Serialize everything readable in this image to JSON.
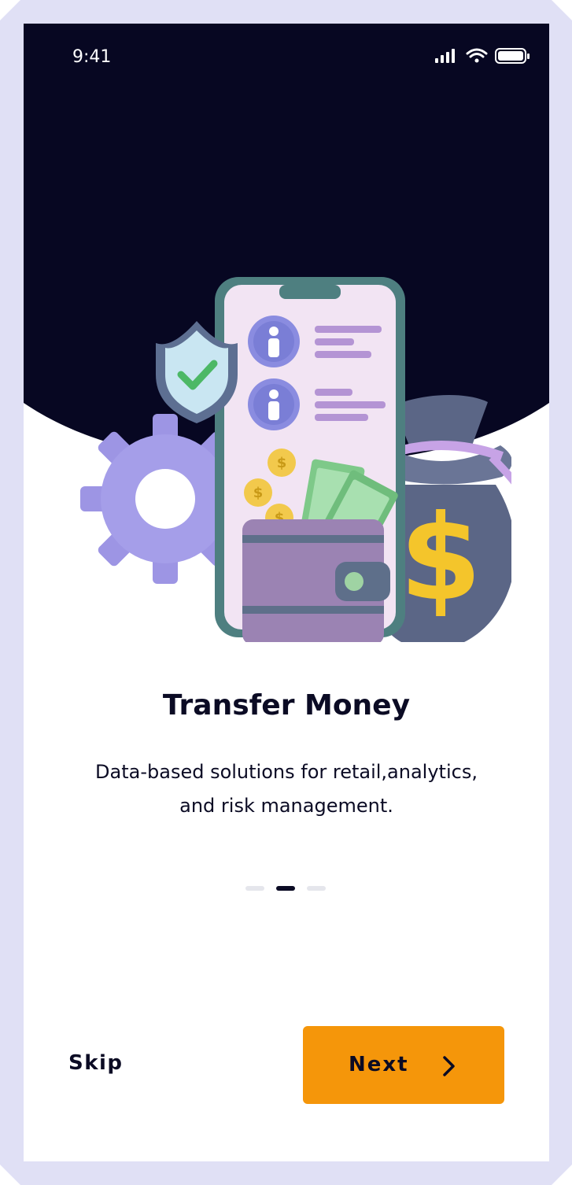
{
  "status_bar": {
    "time": "9:41",
    "icons": [
      "signal-bars-icon",
      "wifi-icon",
      "battery-icon"
    ]
  },
  "hero": {
    "illustration": [
      "shield-check-icon",
      "gear-icon",
      "phone-illustration",
      "contact-avatar-icon",
      "coins-icon",
      "banknotes-icon",
      "wallet-icon",
      "money-bag-icon",
      "dollar-sign-icon"
    ]
  },
  "onboarding": {
    "title": "Transfer Money",
    "description_line1": "Data-based solutions for retail,analytics,",
    "description_line2": "and risk management.",
    "page_indicator": {
      "total": 3,
      "current": 2
    }
  },
  "actions": {
    "skip_label": "Skip",
    "next_label": "Next",
    "next_icon": "chevron-right-icon"
  },
  "colors": {
    "frame": "#e0e0f5",
    "hero_background": "#070722",
    "primary_text": "#0b0b24",
    "accent": "#f5960a",
    "dot_inactive": "#e5e6ec"
  }
}
